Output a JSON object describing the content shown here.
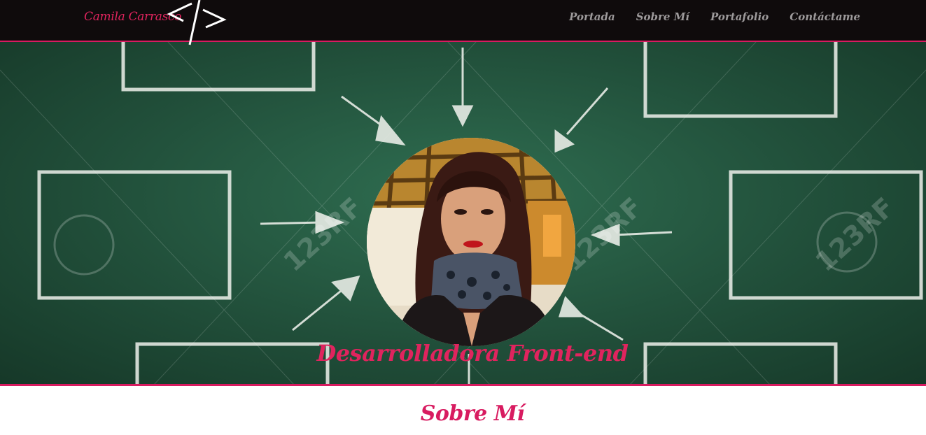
{
  "nav": {
    "brand": "Camila Carrasco",
    "links": [
      "Portada",
      "Sobre Mí",
      "Portafolio",
      "Contáctame"
    ]
  },
  "hero": {
    "title": "Desarrolladora Front-end",
    "watermark": "123RF"
  },
  "about": {
    "title": "Sobre Mí"
  },
  "colors": {
    "accent": "#d81b60",
    "nav_bg": "#0f0b0c",
    "nav_link": "#9d9a9b",
    "chalkboard": "#214f3a"
  }
}
